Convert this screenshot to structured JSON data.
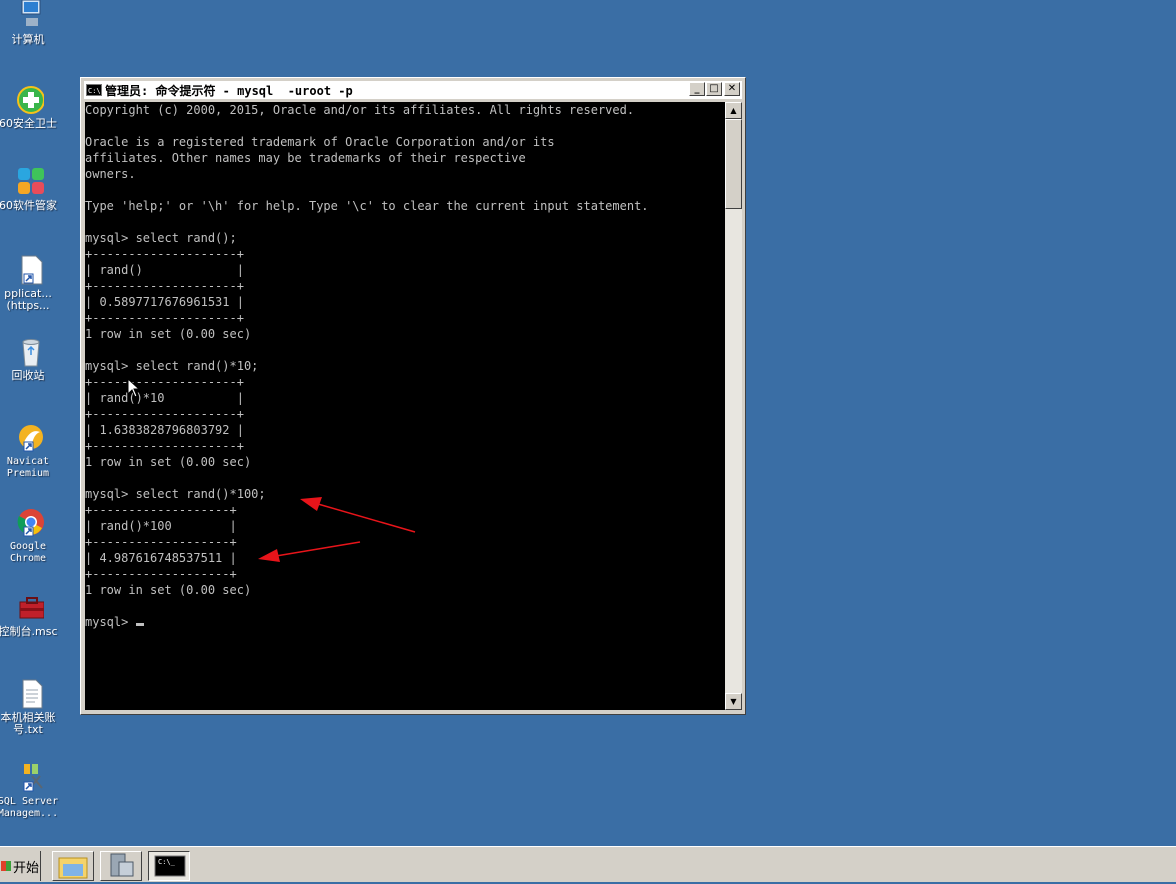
{
  "desktop": {
    "icons": [
      {
        "label": "计算机"
      },
      {
        "label": "60安全卫士"
      },
      {
        "label": "60软件管家"
      },
      {
        "label": "pplicat...\n(https..."
      },
      {
        "label": "回收站"
      },
      {
        "label": "Navicat\nPremium"
      },
      {
        "label": "Google\nChrome"
      },
      {
        "label": "控制台.msc"
      },
      {
        "label": "本机相关账\n号.txt"
      },
      {
        "label": "SQL Server\nManagem..."
      }
    ]
  },
  "console": {
    "title": "管理员: 命令提示符 - mysql  -uroot -p",
    "icon_text": "C:\\",
    "lines": "Copyright (c) 2000, 2015, Oracle and/or its affiliates. All rights reserved.\n\nOracle is a registered trademark of Oracle Corporation and/or its\naffiliates. Other names may be trademarks of their respective\nowners.\n\nType 'help;' or '\\h' for help. Type '\\c' to clear the current input statement.\n\nmysql> select rand();\n+--------------------+\n| rand()             |\n+--------------------+\n| 0.5897717676961531 |\n+--------------------+\n1 row in set (0.00 sec)\n\nmysql> select rand()*10;\n+--------------------+\n| rand()*10          |\n+--------------------+\n| 1.6383828796803792 |\n+--------------------+\n1 row in set (0.00 sec)\n\nmysql> select rand()*100;\n+-------------------+\n| rand()*100        |\n+-------------------+\n| 4.987616748537511 |\n+-------------------+\n1 row in set (0.00 sec)\n\nmysql> ",
    "caption_buttons": {
      "minimize": "_",
      "maximize": "□",
      "close": "✕"
    }
  },
  "taskbar": {
    "start_label": "开始"
  },
  "colors": {
    "desktop": "#3a6ea5",
    "console_bg": "#000000",
    "console_fg": "#c0c0c0",
    "annotation": "#e8141a"
  }
}
